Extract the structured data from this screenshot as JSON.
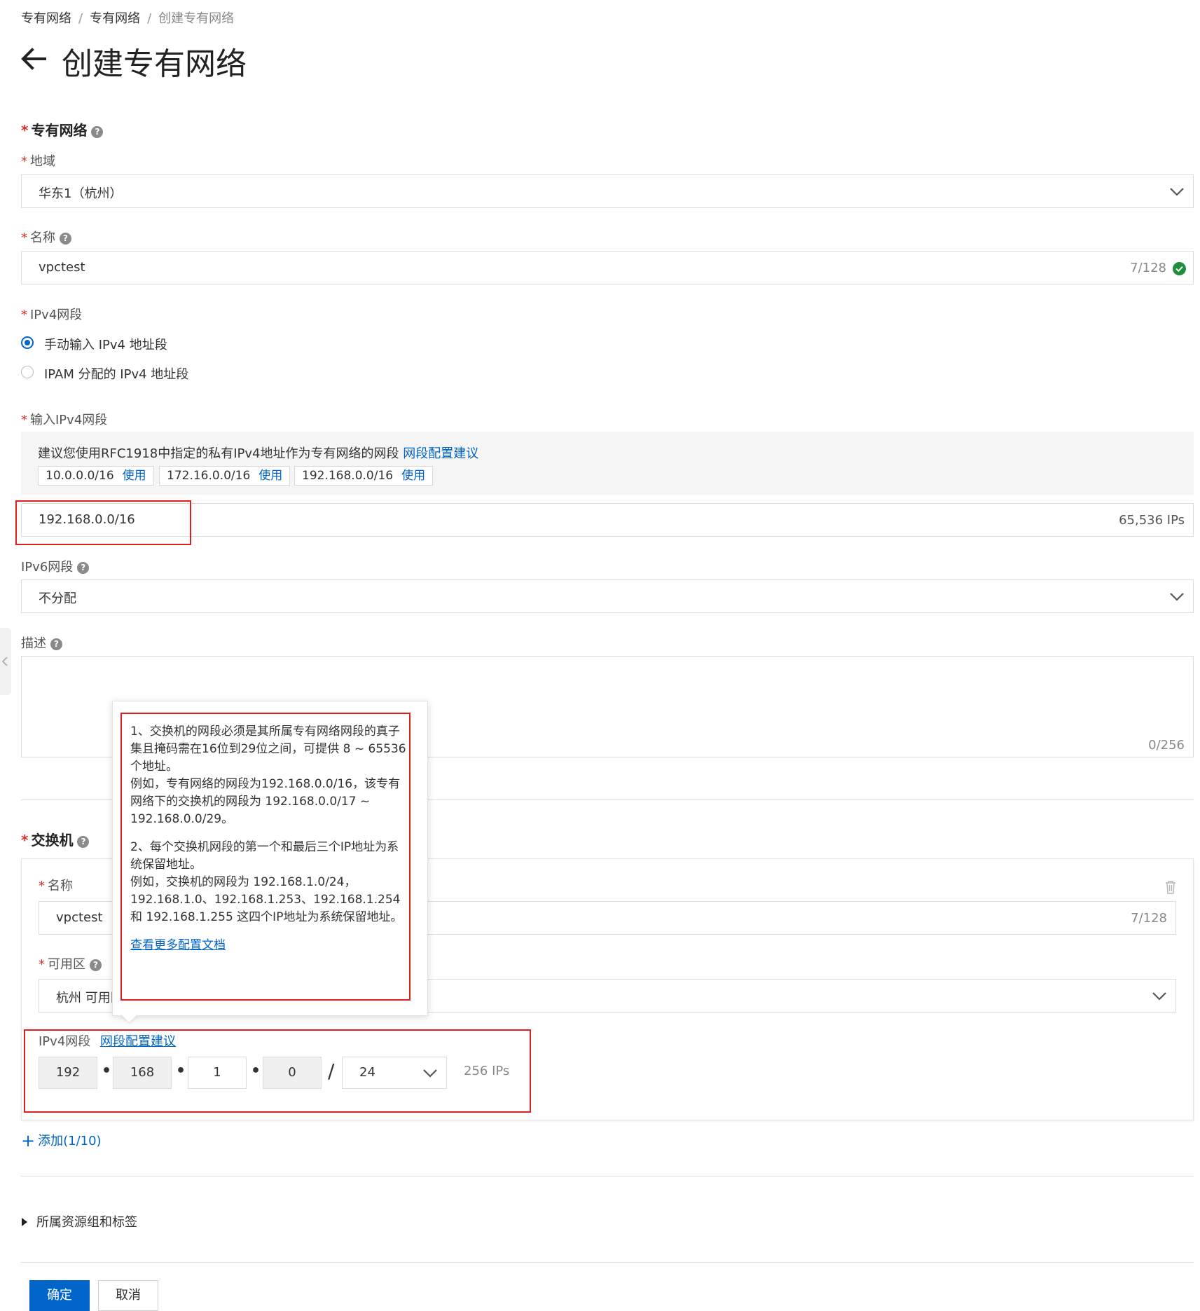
{
  "breadcrumb": {
    "items": [
      "专有网络",
      "专有网络",
      "创建专有网络"
    ],
    "separator": "/"
  },
  "page": {
    "title": "创建专有网络",
    "back_icon": "arrow-left-icon"
  },
  "vpc_section": {
    "required_mark": "*",
    "title": "专有网络",
    "help_icon": "?",
    "region": {
      "label": "地域",
      "value": "华东1（杭州）"
    },
    "name": {
      "label": "名称",
      "value": "vpctest",
      "counter": "7/128"
    },
    "ipv4_mode": {
      "label": "IPv4网段",
      "options": [
        {
          "label": "手动输入 IPv4 地址段",
          "selected": true
        },
        {
          "label": "IPAM 分配的 IPv4 地址段",
          "selected": false
        }
      ]
    },
    "ipv4_input": {
      "label": "输入IPv4网段",
      "suggestion_text": "建议您使用RFC1918中指定的私有IPv4地址作为专有网络的网段",
      "suggestion_link": "网段配置建议",
      "presets": [
        {
          "cidr": "10.0.0.0/16",
          "action": "使用"
        },
        {
          "cidr": "172.16.0.0/16",
          "action": "使用"
        },
        {
          "cidr": "192.168.0.0/16",
          "action": "使用"
        }
      ],
      "value": "192.168.0.0/16",
      "ip_count": "65,536 IPs"
    },
    "ipv6": {
      "label": "IPv6网段",
      "value": "不分配"
    },
    "description": {
      "label": "描述",
      "value": "",
      "counter": "0/256"
    }
  },
  "vswitch_section": {
    "required_mark": "*",
    "title": "交换机",
    "help_icon": "?",
    "name": {
      "label": "名称",
      "value": "vpctest",
      "counter": "7/128"
    },
    "zone": {
      "label": "可用区",
      "value": "杭州 可用区"
    },
    "ipv4": {
      "label": "IPv4网段",
      "link": "网段配置建议",
      "octets": [
        "192",
        "168",
        "1",
        "0"
      ],
      "separator_dot": "•",
      "slash": "/",
      "mask": "24",
      "ip_count": "256 IPs"
    },
    "add_button": "添加(1/10)",
    "add_icon": "+",
    "delete_icon": "trash-icon"
  },
  "tooltip": {
    "paragraphs": [
      "1、交换机的网段必须是其所属专有网络网段的真子集且掩码需在16位到29位之间，可提供 8 ~ 65536 个地址。\n例如，专有网络的网段为192.168.0.0/16，该专有网络下的交换机的网段为 192.168.0.0/17 ~ 192.168.0.0/29。",
      "2、每个交换机网段的第一个和最后三个IP地址为系统保留地址。\n例如，交换机的网段为 192.168.1.0/24，192.168.1.0、192.168.1.253、192.168.1.254 和 192.168.1.255 这四个IP地址为系统保留地址。"
    ],
    "link": "查看更多配置文档"
  },
  "resource_group": {
    "label": "所属资源组和标签",
    "expand_icon": "caret-right-icon"
  },
  "footer": {
    "confirm": "确定",
    "cancel": "取消"
  },
  "colors": {
    "primary": "#0064c8",
    "required": "#d93026",
    "annotation": "#e02020",
    "success": "#1e8e3e"
  }
}
